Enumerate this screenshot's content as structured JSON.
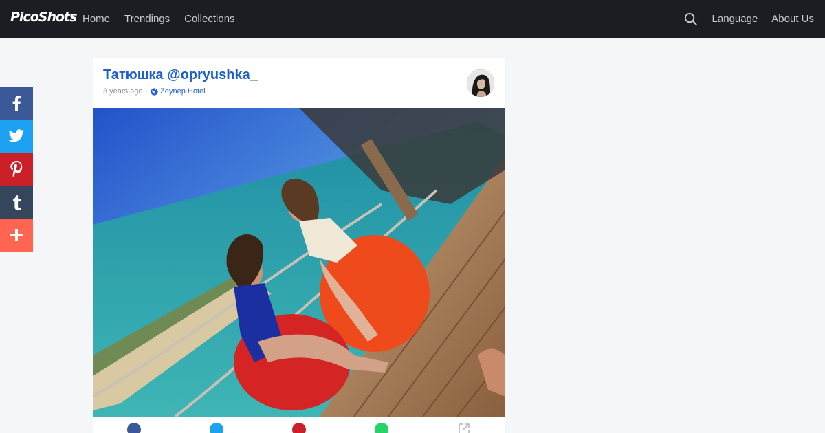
{
  "brand": {
    "logo_text": "PicoShots"
  },
  "nav": {
    "home": "Home",
    "trendings": "Trendings",
    "collections": "Collections"
  },
  "right_nav": {
    "language": "Language",
    "about": "About Us"
  },
  "share_rail": [
    {
      "icon": "facebook-icon",
      "color": "#3b5998"
    },
    {
      "icon": "twitter-icon",
      "color": "#1da1f2"
    },
    {
      "icon": "pinterest-icon",
      "color": "#cb2027"
    },
    {
      "icon": "tumblr-icon",
      "color": "#35465c"
    },
    {
      "icon": "plus-icon",
      "color": "#ff6550"
    }
  ],
  "post": {
    "title": "Татюшка @opryushka_",
    "time": "3 years ago",
    "separator": "·",
    "location": "Zeynep Hotel"
  },
  "actions": [
    {
      "icon": "facebook-icon",
      "color": "#3b5998"
    },
    {
      "icon": "twitter-icon",
      "color": "#1da1f2"
    },
    {
      "icon": "pinterest-icon",
      "color": "#cb2027"
    },
    {
      "icon": "whatsapp-icon",
      "color": "#25d366"
    },
    {
      "icon": "external-link-icon",
      "color": "#b5b8bd"
    }
  ],
  "colors": {
    "topbar": "#1b1d22",
    "link": "#1d5fd1",
    "page_bg": "#f5f6f8"
  }
}
